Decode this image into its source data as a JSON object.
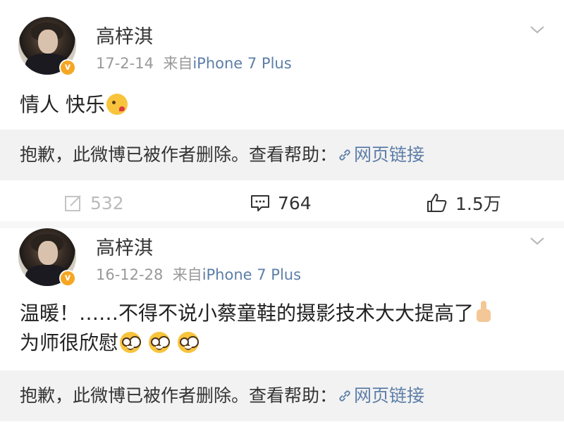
{
  "posts": [
    {
      "author": "高梓淇",
      "date": "17-2-14",
      "source_prefix": "来自",
      "source": "iPhone 7 Plus",
      "text_line1": "情人 快乐",
      "text_line1_emojis": [
        "kiss-emoji"
      ],
      "deleted_notice": "抱歉，此微博已被作者删除。查看帮助：",
      "deleted_link": "网页链接",
      "actions": {
        "repost": "532",
        "comment": "764",
        "like": "1.5万"
      }
    },
    {
      "author": "高梓淇",
      "date": "16-12-28",
      "source_prefix": "来自",
      "source": "iPhone 7 Plus",
      "text_line1": "温暖！……不得不说小蔡童鞋的摄影技术大大提高了",
      "text_line1_emojis": [
        "thumbs-up-emoji"
      ],
      "text_line2": "为师很欣慰",
      "text_line2_emojis": [
        "nerd-emoji",
        "nerd-emoji",
        "nerd-emoji"
      ],
      "deleted_notice": "抱歉，此微博已被作者删除。查看帮助：",
      "deleted_link": "网页链接"
    }
  ],
  "colors": {
    "link": "#5d7ea8",
    "verified": "#f5a623",
    "muted": "#999999",
    "deleted_bg": "#f2f2f2"
  },
  "icons": [
    "chevron-down-icon",
    "verified-badge-icon",
    "link-icon",
    "repost-icon",
    "comment-icon",
    "like-icon"
  ]
}
